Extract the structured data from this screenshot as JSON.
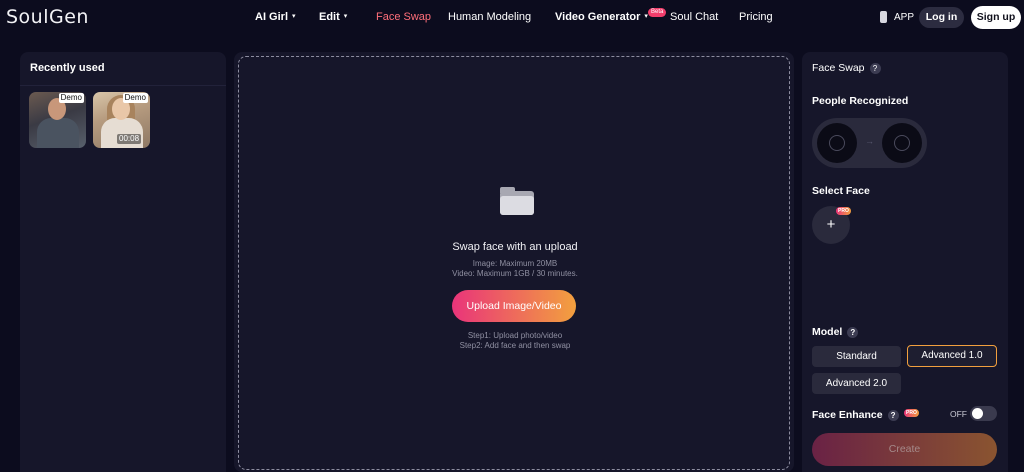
{
  "header": {
    "logo": "SoulGen",
    "nav": [
      {
        "label": "AI Girl",
        "caret": "▾"
      },
      {
        "label": "Edit",
        "caret": "▾"
      },
      {
        "label": "Face Swap"
      },
      {
        "label": "Human Modeling"
      },
      {
        "label": "Video Generator",
        "caret": "▾",
        "badge": "Beta"
      },
      {
        "label": "Soul Chat"
      },
      {
        "label": "Pricing"
      }
    ],
    "app_label": "APP",
    "login_label": "Log in",
    "signup_label": "Sign up"
  },
  "left_panel": {
    "title": "Recently used",
    "items": [
      {
        "tag": "Demo"
      },
      {
        "tag": "Demo",
        "duration": "00:08"
      }
    ]
  },
  "upload": {
    "title": "Swap face with an upload",
    "limit_image": "Image: Maximum 20MB",
    "limit_video": "Video: Maximum 1GB / 30 minutes.",
    "button_label": "Upload Image/Video",
    "step1": "Step1: Upload photo/video",
    "step2": "Step2: Add face and then swap"
  },
  "right_panel": {
    "title": "Face Swap",
    "help": "?",
    "people_recognized_label": "People Recognized",
    "arrow": "→",
    "select_face_label": "Select Face",
    "add_face": "+",
    "pro_badge": "PRO",
    "model_label": "Model",
    "models": [
      "Standard",
      "Advanced 1.0",
      "Advanced 2.0"
    ],
    "selected_model": "Advanced 1.0",
    "face_enhance_label": "Face Enhance",
    "face_enhance_state": "OFF",
    "create_label": "Create"
  },
  "colors": {
    "background": "#0c0c1e",
    "panel": "#16162a",
    "accent_active": "#ff6f7a",
    "gradient_start": "#e9347a",
    "gradient_end": "#f2a03e"
  }
}
